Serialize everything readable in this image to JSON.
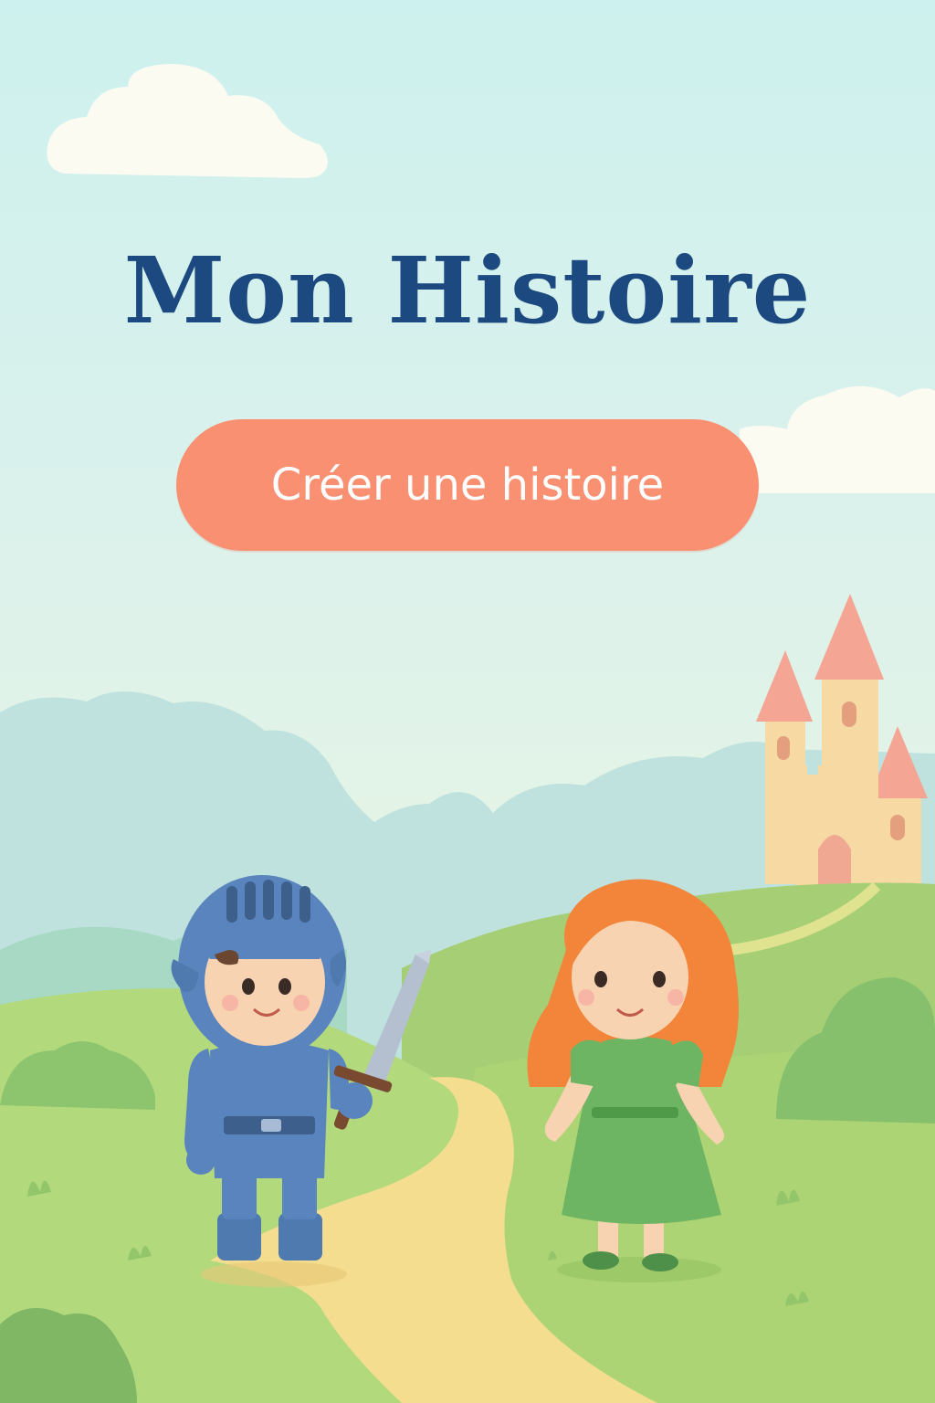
{
  "title": "Mon Histoire",
  "cta": {
    "label": "Créer une histoire"
  },
  "colors": {
    "title": "#1c4a80",
    "button": "#f99072",
    "button_text": "#ffffff",
    "sky": "#cdf1ee",
    "grass": "#9fcc6e",
    "path": "#f4dc8d",
    "castle": "#f7d9a3",
    "castle_roof": "#f4a593",
    "knight_armor": "#5a84bd",
    "girl_hair": "#f2853a",
    "girl_dress": "#6db562"
  },
  "icons": [
    "cloud-icon",
    "castle-icon",
    "knight-icon",
    "girl-icon",
    "sword-icon"
  ]
}
